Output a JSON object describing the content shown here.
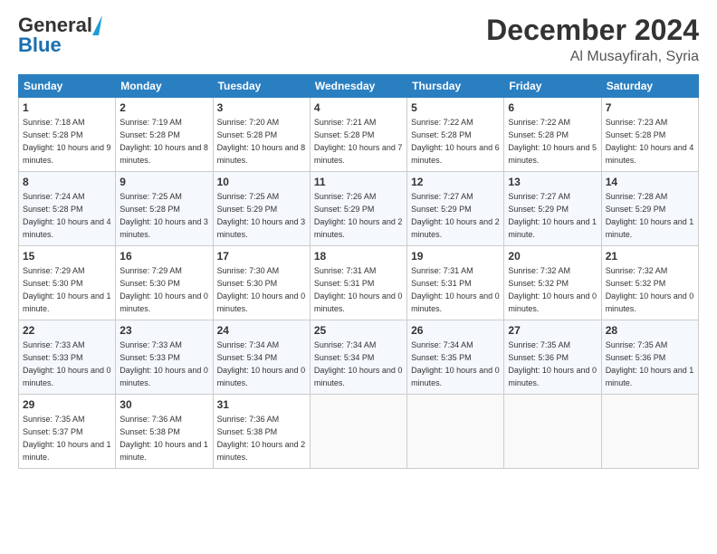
{
  "header": {
    "logo_general": "General",
    "logo_blue": "Blue",
    "title": "December 2024",
    "location": "Al Musayfirah, Syria"
  },
  "weekdays": [
    "Sunday",
    "Monday",
    "Tuesday",
    "Wednesday",
    "Thursday",
    "Friday",
    "Saturday"
  ],
  "weeks": [
    [
      {
        "day": "1",
        "sunrise": "7:18 AM",
        "sunset": "5:28 PM",
        "daylight": "10 hours and 9 minutes."
      },
      {
        "day": "2",
        "sunrise": "7:19 AM",
        "sunset": "5:28 PM",
        "daylight": "10 hours and 8 minutes."
      },
      {
        "day": "3",
        "sunrise": "7:20 AM",
        "sunset": "5:28 PM",
        "daylight": "10 hours and 8 minutes."
      },
      {
        "day": "4",
        "sunrise": "7:21 AM",
        "sunset": "5:28 PM",
        "daylight": "10 hours and 7 minutes."
      },
      {
        "day": "5",
        "sunrise": "7:22 AM",
        "sunset": "5:28 PM",
        "daylight": "10 hours and 6 minutes."
      },
      {
        "day": "6",
        "sunrise": "7:22 AM",
        "sunset": "5:28 PM",
        "daylight": "10 hours and 5 minutes."
      },
      {
        "day": "7",
        "sunrise": "7:23 AM",
        "sunset": "5:28 PM",
        "daylight": "10 hours and 4 minutes."
      }
    ],
    [
      {
        "day": "8",
        "sunrise": "7:24 AM",
        "sunset": "5:28 PM",
        "daylight": "10 hours and 4 minutes."
      },
      {
        "day": "9",
        "sunrise": "7:25 AM",
        "sunset": "5:28 PM",
        "daylight": "10 hours and 3 minutes."
      },
      {
        "day": "10",
        "sunrise": "7:25 AM",
        "sunset": "5:29 PM",
        "daylight": "10 hours and 3 minutes."
      },
      {
        "day": "11",
        "sunrise": "7:26 AM",
        "sunset": "5:29 PM",
        "daylight": "10 hours and 2 minutes."
      },
      {
        "day": "12",
        "sunrise": "7:27 AM",
        "sunset": "5:29 PM",
        "daylight": "10 hours and 2 minutes."
      },
      {
        "day": "13",
        "sunrise": "7:27 AM",
        "sunset": "5:29 PM",
        "daylight": "10 hours and 1 minute."
      },
      {
        "day": "14",
        "sunrise": "7:28 AM",
        "sunset": "5:29 PM",
        "daylight": "10 hours and 1 minute."
      }
    ],
    [
      {
        "day": "15",
        "sunrise": "7:29 AM",
        "sunset": "5:30 PM",
        "daylight": "10 hours and 1 minute."
      },
      {
        "day": "16",
        "sunrise": "7:29 AM",
        "sunset": "5:30 PM",
        "daylight": "10 hours and 0 minutes."
      },
      {
        "day": "17",
        "sunrise": "7:30 AM",
        "sunset": "5:30 PM",
        "daylight": "10 hours and 0 minutes."
      },
      {
        "day": "18",
        "sunrise": "7:31 AM",
        "sunset": "5:31 PM",
        "daylight": "10 hours and 0 minutes."
      },
      {
        "day": "19",
        "sunrise": "7:31 AM",
        "sunset": "5:31 PM",
        "daylight": "10 hours and 0 minutes."
      },
      {
        "day": "20",
        "sunrise": "7:32 AM",
        "sunset": "5:32 PM",
        "daylight": "10 hours and 0 minutes."
      },
      {
        "day": "21",
        "sunrise": "7:32 AM",
        "sunset": "5:32 PM",
        "daylight": "10 hours and 0 minutes."
      }
    ],
    [
      {
        "day": "22",
        "sunrise": "7:33 AM",
        "sunset": "5:33 PM",
        "daylight": "10 hours and 0 minutes."
      },
      {
        "day": "23",
        "sunrise": "7:33 AM",
        "sunset": "5:33 PM",
        "daylight": "10 hours and 0 minutes."
      },
      {
        "day": "24",
        "sunrise": "7:34 AM",
        "sunset": "5:34 PM",
        "daylight": "10 hours and 0 minutes."
      },
      {
        "day": "25",
        "sunrise": "7:34 AM",
        "sunset": "5:34 PM",
        "daylight": "10 hours and 0 minutes."
      },
      {
        "day": "26",
        "sunrise": "7:34 AM",
        "sunset": "5:35 PM",
        "daylight": "10 hours and 0 minutes."
      },
      {
        "day": "27",
        "sunrise": "7:35 AM",
        "sunset": "5:36 PM",
        "daylight": "10 hours and 0 minutes."
      },
      {
        "day": "28",
        "sunrise": "7:35 AM",
        "sunset": "5:36 PM",
        "daylight": "10 hours and 1 minute."
      }
    ],
    [
      {
        "day": "29",
        "sunrise": "7:35 AM",
        "sunset": "5:37 PM",
        "daylight": "10 hours and 1 minute."
      },
      {
        "day": "30",
        "sunrise": "7:36 AM",
        "sunset": "5:38 PM",
        "daylight": "10 hours and 1 minute."
      },
      {
        "day": "31",
        "sunrise": "7:36 AM",
        "sunset": "5:38 PM",
        "daylight": "10 hours and 2 minutes."
      },
      null,
      null,
      null,
      null
    ]
  ]
}
